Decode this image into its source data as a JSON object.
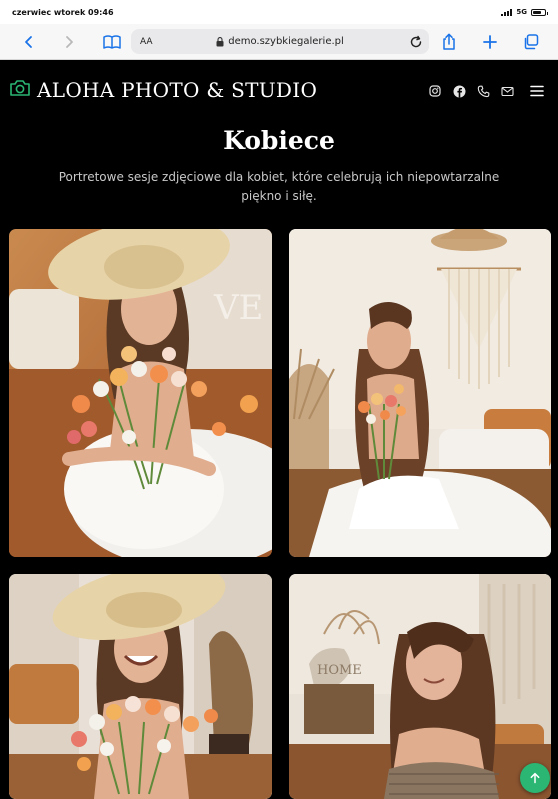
{
  "status": {
    "datetime": "czerwiec wtorek 09:46",
    "network": "5G"
  },
  "browser": {
    "aa_label": "AA",
    "url": "demo.szybkiegalerie.pl"
  },
  "site": {
    "brand": "ALOHA PHOTO & STUDIO",
    "social_icons": [
      "instagram-icon",
      "facebook-icon",
      "phone-icon",
      "mail-icon"
    ]
  },
  "gallery": {
    "title": "Kobiece",
    "description": "Portretowe sesje zdjęciowe dla kobiet, które celebrują ich niepowtarzalne piękno i siłę."
  },
  "colors": {
    "accent": "#2bb673",
    "background": "#000000",
    "text": "#ffffff",
    "muted_text": "#c9c9c9"
  }
}
